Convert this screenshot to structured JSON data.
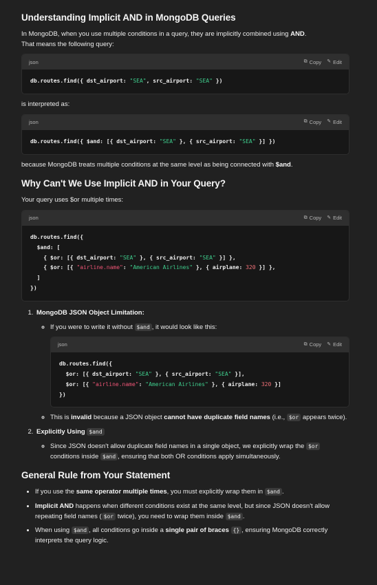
{
  "section1": {
    "title": "Understanding Implicit AND in MongoDB Queries",
    "intro_a": "In MongoDB, when you use multiple conditions in a query, they are implicitly combined using ",
    "intro_bold": "AND",
    "intro_b": ".",
    "intro_line2": "That means the following query:",
    "code1": {
      "lang": "json",
      "copy": "Copy",
      "edit": "Edit"
    },
    "interpreted": "is interpreted as:",
    "code2": {
      "lang": "json",
      "copy": "Copy",
      "edit": "Edit"
    },
    "because_a": "because MongoDB treats multiple conditions at the same level as being connected with ",
    "because_bold": "$and",
    "because_b": "."
  },
  "section2": {
    "title": "Why Can't We Use Implicit AND in Your Query?",
    "intro": "Your query uses $or multiple times:",
    "code3": {
      "lang": "json",
      "copy": "Copy",
      "edit": "Edit"
    },
    "item1_title": "MongoDB JSON Object Limitation:",
    "item1_bullet_a": "If you were to write it without ",
    "item1_bullet_code": "$and",
    "item1_bullet_b": ", it would look like this:",
    "code4": {
      "lang": "json",
      "copy": "Copy",
      "edit": "Edit"
    },
    "item1_bullet2_a": "This is ",
    "item1_bullet2_bold1": "invalid",
    "item1_bullet2_b": " because a JSON object ",
    "item1_bullet2_bold2": "cannot have duplicate field names",
    "item1_bullet2_c": " (i.e., ",
    "item1_bullet2_code": "$or",
    "item1_bullet2_d": " appears twice).",
    "item2_title": "Explicitly Using ",
    "item2_title_code": "$and",
    "item2_bullet_a": "Since JSON doesn't allow duplicate field names in a single object, we explicitly wrap the ",
    "item2_bullet_code1": "$or",
    "item2_bullet_b": " conditions inside ",
    "item2_bullet_code2": "$and",
    "item2_bullet_c": ", ensuring that both OR conditions apply simultaneously."
  },
  "section3": {
    "title": "General Rule from Your Statement",
    "b1_a": "If you use the ",
    "b1_bold": "same operator multiple times",
    "b1_b": ", you must explicitly wrap them in ",
    "b1_code": "$and",
    "b1_c": ".",
    "b2_bold": "Implicit AND",
    "b2_a": " happens when different conditions exist at the same level, but since JSON doesn't allow repeating field names (",
    "b2_code1": "$or",
    "b2_b": " twice), you need to wrap them inside ",
    "b2_code2": "$and",
    "b2_c": ".",
    "b3_a": "When using ",
    "b3_code1": "$and",
    "b3_b": ", all conditions go inside a ",
    "b3_bold": "single pair of braces",
    "b3_c": " ",
    "b3_code2": "{}",
    "b3_d": ", ensuring MongoDB correctly interprets the query logic."
  },
  "code": {
    "c1": {
      "a": "db.routes.find({ dst_airport: ",
      "s1": "\"SEA\"",
      "b": ", src_airport: ",
      "s2": "\"SEA\"",
      "c": " })"
    },
    "c2": {
      "a": "db.routes.find({ $and: [{ dst_airport: ",
      "s1": "\"SEA\"",
      "b": " }, { src_airport: ",
      "s2": "\"SEA\"",
      "c": " }] })"
    },
    "c3": {
      "l1": "db.routes.find({",
      "l2": "  $and: [",
      "l3a": "    { $or: [{ dst_airport: ",
      "l3s1": "\"SEA\"",
      "l3b": " }, { src_airport: ",
      "l3s2": "\"SEA\"",
      "l3c": " }] },",
      "l4a": "    { $or: [{ ",
      "l4k": "\"airline.name\"",
      "l4b": ": ",
      "l4s": "\"American Airlines\"",
      "l4c": " }, { airplane: ",
      "l4n": "320",
      "l4d": " }] },",
      "l5": "  ]",
      "l6": "})"
    },
    "c4": {
      "l1": "db.routes.find({",
      "l2a": "  $or: [{ dst_airport: ",
      "l2s1": "\"SEA\"",
      "l2b": " }, { src_airport: ",
      "l2s2": "\"SEA\"",
      "l2c": " }],",
      "l3a": "  $or: [{ ",
      "l3k": "\"airline.name\"",
      "l3b": ": ",
      "l3s": "\"American Airlines\"",
      "l3c": " }, { airplane: ",
      "l3n": "320",
      "l3d": " }]",
      "l4": "})"
    }
  },
  "icons": {
    "copy": "copy-icon",
    "edit": "edit-icon"
  }
}
